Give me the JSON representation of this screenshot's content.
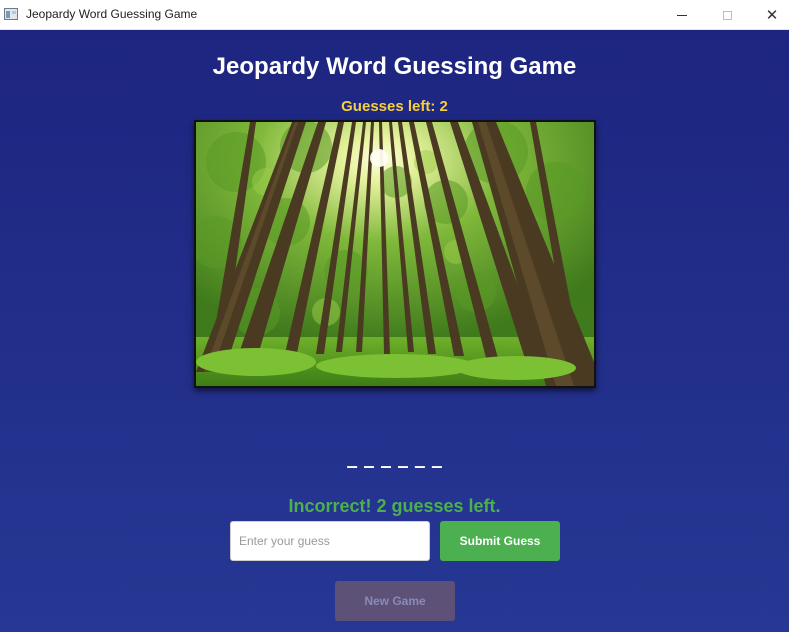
{
  "window": {
    "title": "Jeopardy Word Guessing Game",
    "controls": {
      "minimize": "—",
      "maximize": "☐",
      "close": "✕"
    }
  },
  "game": {
    "title": "Jeopardy Word Guessing Game",
    "guesses_left": "Guesses left: 2",
    "clue_image": {
      "subject": "sunlit forest of tall trees viewed from below",
      "icon": "forest-photo"
    },
    "word_blanks": "_ _ _ _ _ _",
    "feedback": "Incorrect! 2 guesses left.",
    "feedback_color": "#4caf50"
  },
  "input": {
    "value": "",
    "placeholder": "Enter your guess"
  },
  "buttons": {
    "submit": "Submit Guess",
    "new_game": "New Game"
  },
  "colors": {
    "background": "#1f2b82",
    "accent_yellow": "#f5cf3c",
    "submit_green": "#4caf50",
    "new_game_disabled": "#5e5178"
  }
}
